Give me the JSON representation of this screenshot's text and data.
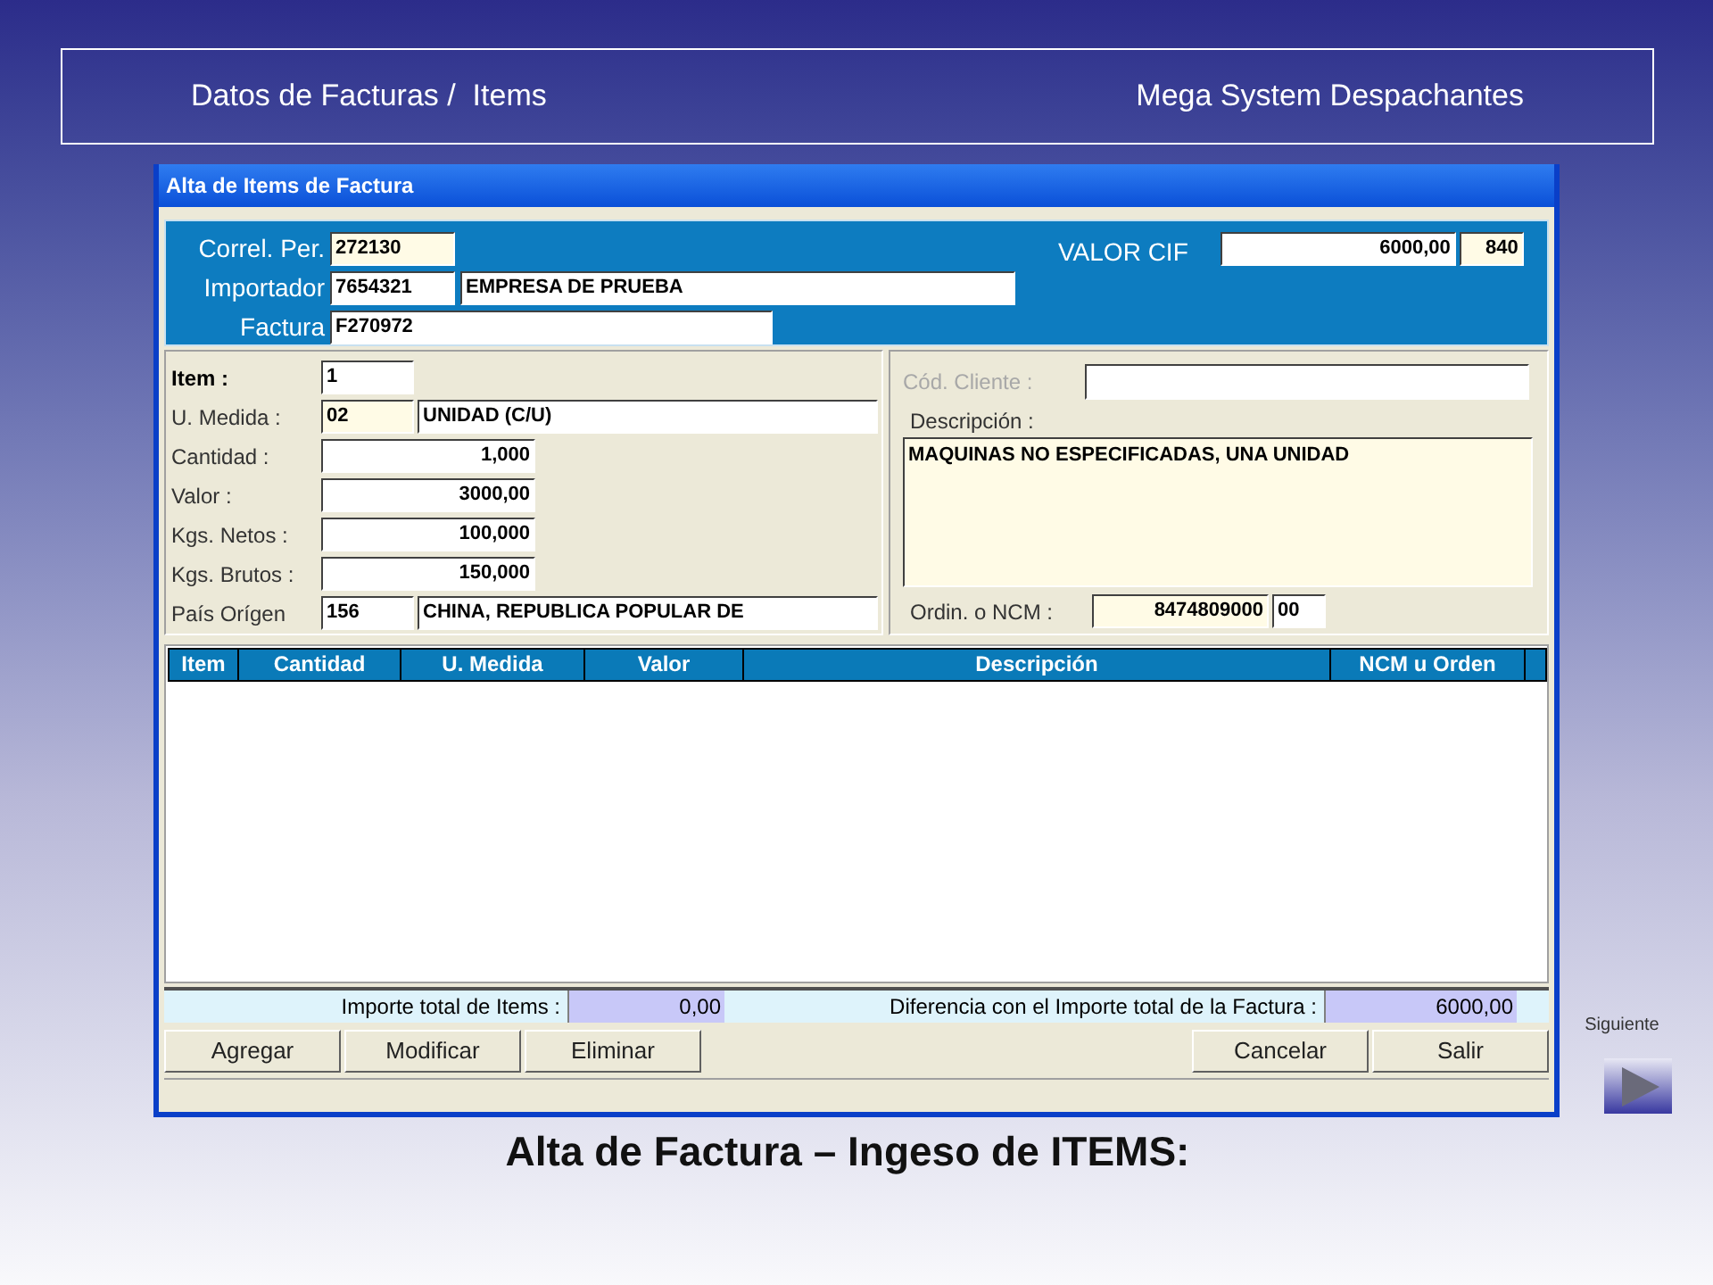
{
  "header": {
    "title": "Datos de Facturas /  Items",
    "brand": "Mega System Despachantes"
  },
  "window": {
    "title": "Alta de Items de Factura"
  },
  "invoice": {
    "correl": {
      "label": "Correl. Per.",
      "value": "272130"
    },
    "importador": {
      "label": "Importador",
      "code": "7654321",
      "name": "EMPRESA DE PRUEBA"
    },
    "factura": {
      "label": "Factura",
      "value": "F270972"
    },
    "valor_cif": {
      "label": "VALOR CIF",
      "amount": "6000,00",
      "currency": "840"
    }
  },
  "item_fields": [
    {
      "label": "Item :",
      "bold": true,
      "kind": "short",
      "values": [
        "1"
      ]
    },
    {
      "label": "U. Medida :",
      "bold": false,
      "kind": "code",
      "values": [
        "02",
        "UNIDAD (C/U)"
      ]
    },
    {
      "label": "Cantidad :",
      "bold": false,
      "kind": "number",
      "values": [
        "1,000"
      ]
    },
    {
      "label": "Valor :",
      "bold": false,
      "kind": "number",
      "values": [
        "3000,00"
      ]
    },
    {
      "label": "Kgs. Netos :",
      "bold": false,
      "kind": "number",
      "values": [
        "100,000"
      ]
    },
    {
      "label": "Kgs. Brutos :",
      "bold": false,
      "kind": "number",
      "values": [
        "150,000"
      ]
    },
    {
      "label": "País Orígen",
      "bold": false,
      "kind": "code",
      "values": [
        "156",
        "CHINA, REPUBLICA POPULAR DE"
      ]
    }
  ],
  "cod_cliente": {
    "label": "Cód. Cliente :",
    "disabled": true
  },
  "descripcion": {
    "label": "Descripción :",
    "value": "MAQUINAS NO ESPECIFICADAS, UNA UNIDAD"
  },
  "ncm": {
    "label": "Ordin. o NCM :",
    "code": "8474809000",
    "suffix": "00"
  },
  "table": {
    "columns": [
      "Item",
      "Cantidad",
      "U. Medida",
      "Valor",
      "Descripción",
      "NCM u Orden"
    ]
  },
  "totals": {
    "items_label": "Importe total de Items :",
    "items_value": "0,00",
    "diff_label": "Diferencia con el Importe total de la Factura :",
    "diff_value": "6000,00"
  },
  "buttons_left": [
    "Agregar",
    "Modificar",
    "Eliminar"
  ],
  "buttons_right": [
    "Cancelar",
    "Salir"
  ],
  "slide": {
    "next_label": "Siguiente",
    "caption": "Alta de Factura – Ingeso de ITEMS:"
  }
}
